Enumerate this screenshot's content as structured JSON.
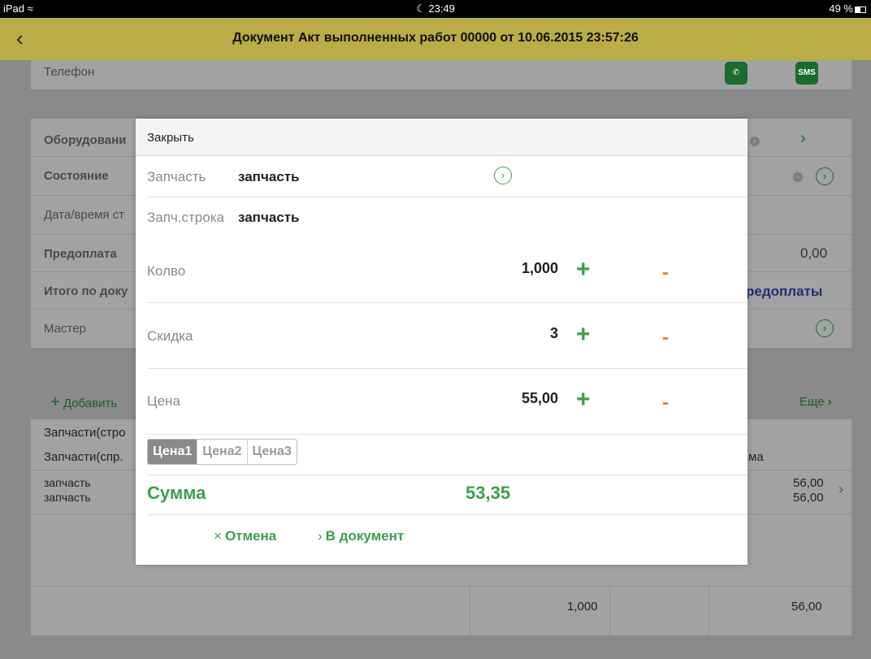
{
  "status_bar": {
    "device": "iPad",
    "time": "23:49",
    "battery": "49 %"
  },
  "nav": {
    "title": "Документ Акт выполненных работ 00000 от 10.06.2015 23:57:26"
  },
  "background": {
    "phone_label": "Телефон",
    "sms_label": "SMS",
    "rows": [
      {
        "label": "Оборудовани"
      },
      {
        "label": "Состояние"
      },
      {
        "label": "Дата/время ст"
      },
      {
        "label": "Предоплата",
        "value": "0,00"
      },
      {
        "label": "Итого по доку",
        "value": "редоплаты"
      },
      {
        "label": "Мастер"
      }
    ],
    "add_label": "Добавить",
    "more_label": "Еще",
    "table": {
      "header1": "Запчасти(стро",
      "header2": "Запчасти(спр.",
      "header_tail": "ма",
      "item_line1": "запчасть",
      "item_line2": "запчасть",
      "amount1": "56,00",
      "amount2": "56,00"
    },
    "footer": {
      "qty": "1,000",
      "total": "56,00"
    }
  },
  "modal": {
    "close_label": "Закрыть",
    "part_label": "Запчасть",
    "part_value": "запчасть",
    "part_row_label": "Запч.строка",
    "part_row_value": "запчасть",
    "qty_label": "Колво",
    "qty_value": "1,000",
    "discount_label": "Скидка",
    "discount_value": "3",
    "price_label": "Цена",
    "price_value": "55,00",
    "price_tabs": [
      "Цена1",
      "Цена2",
      "Цена3"
    ],
    "active_tab": "Цена1",
    "sum_label": "Сумма",
    "sum_value": "53,35",
    "cancel_label": "Отмена",
    "to_document_label": "В документ"
  },
  "colors": {
    "accent_green": "#3aa14a",
    "minus_orange": "#f47c20",
    "nav_yellow": "#e3d24f"
  }
}
